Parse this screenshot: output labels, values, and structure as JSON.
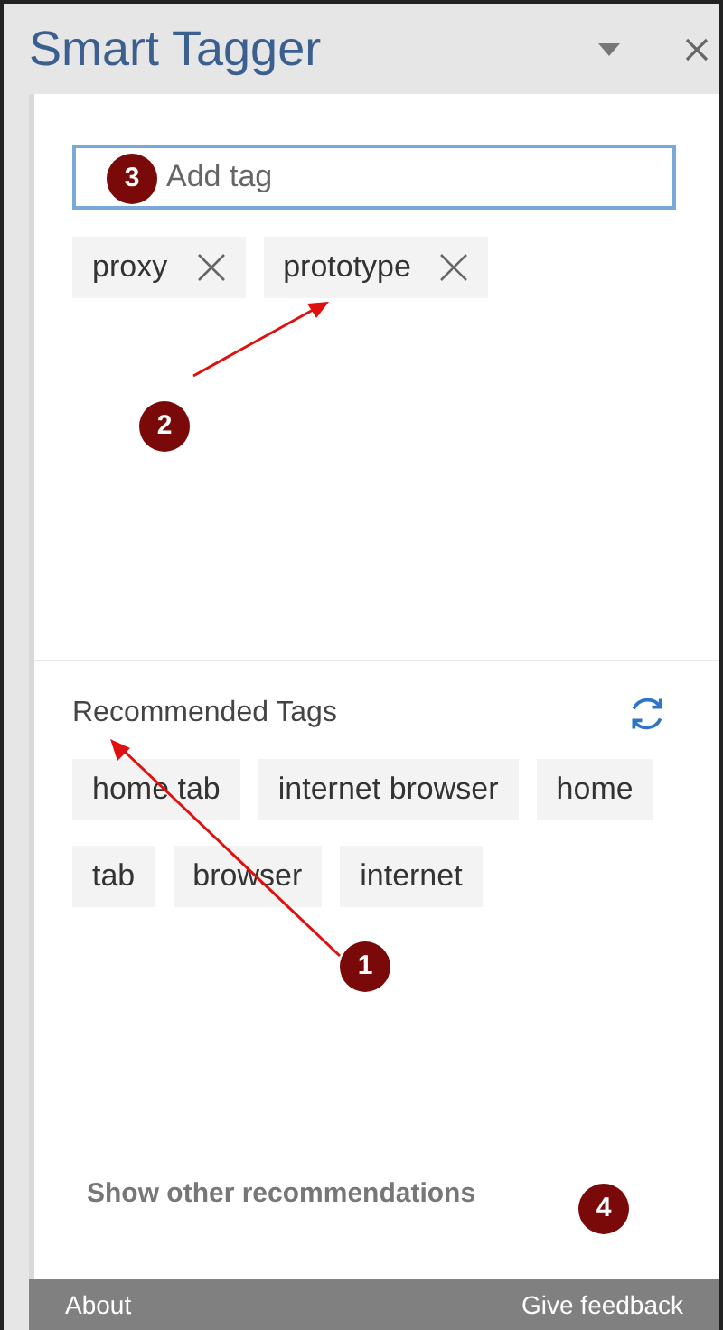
{
  "window": {
    "title": "Smart Tagger"
  },
  "tag_input": {
    "placeholder": "Add tag"
  },
  "applied_tags": [
    {
      "label": "proxy"
    },
    {
      "label": "prototype"
    }
  ],
  "recommended": {
    "title": "Recommended Tags",
    "tags": [
      {
        "label": "home tab"
      },
      {
        "label": "internet browser"
      },
      {
        "label": "home"
      },
      {
        "label": "tab"
      },
      {
        "label": "browser"
      },
      {
        "label": "internet"
      }
    ],
    "more_link": "Show other recommendations"
  },
  "footer": {
    "left": "About",
    "right": "Give feedback"
  },
  "annotations": [
    {
      "number": "1"
    },
    {
      "number": "2"
    },
    {
      "number": "3"
    },
    {
      "number": "4"
    }
  ]
}
